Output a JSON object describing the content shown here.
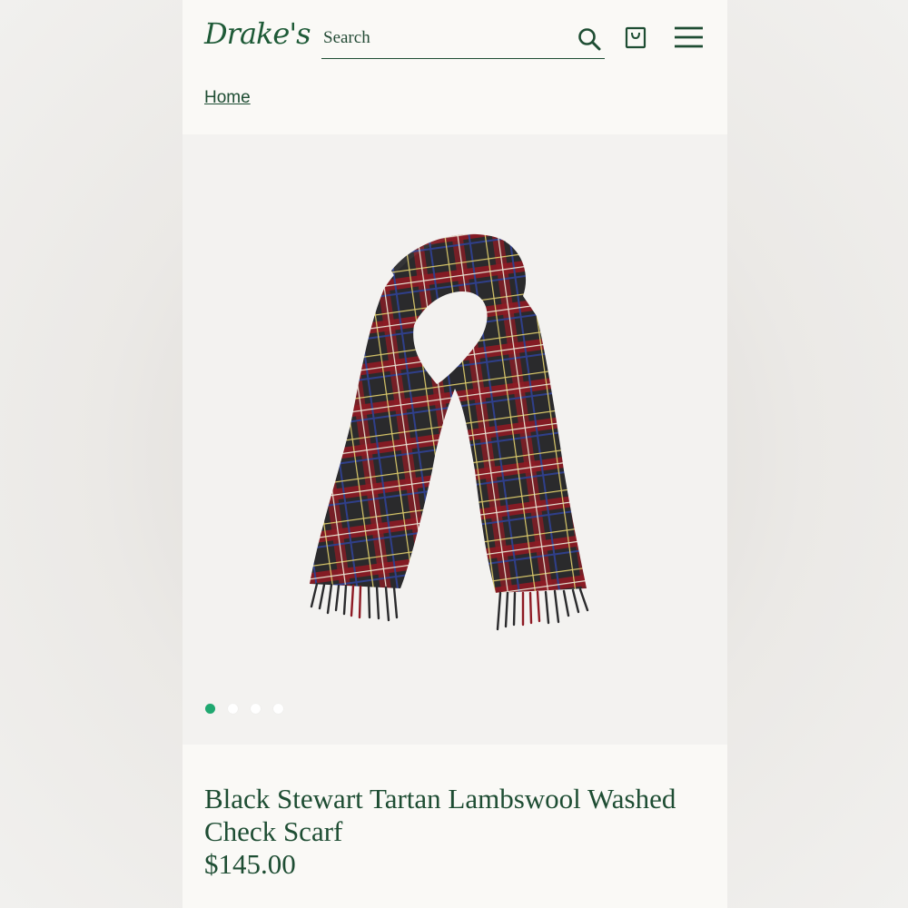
{
  "brand": {
    "logo_text": "Drake's"
  },
  "search": {
    "placeholder": "Search",
    "value": ""
  },
  "icons": {
    "search": "search-icon",
    "cart": "shopping-bag-icon",
    "menu": "hamburger-menu-icon"
  },
  "breadcrumb": {
    "home": "Home"
  },
  "gallery": {
    "image_count": 4,
    "active_index": 0,
    "active_dot_color": "#1fa870"
  },
  "product": {
    "title": "Black Stewart Tartan Lambswool Washed Check Scarf",
    "price": "$145.00"
  },
  "colors": {
    "brand_green": "#1e4d33",
    "background": "#faf9f6"
  }
}
